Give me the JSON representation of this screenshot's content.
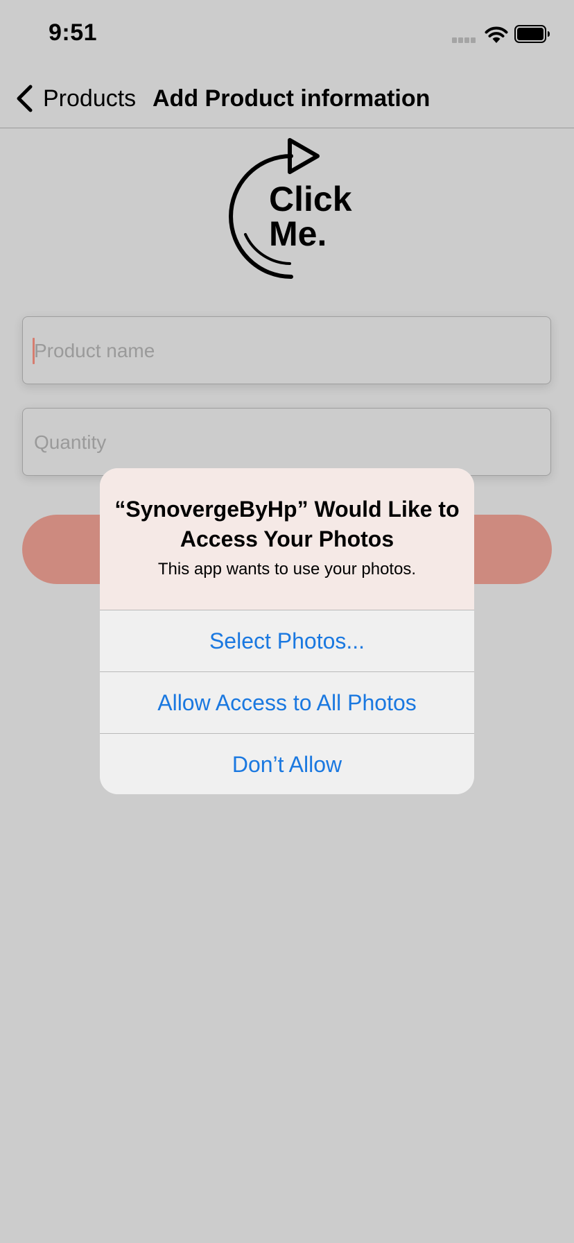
{
  "status_bar": {
    "time": "9:51"
  },
  "nav": {
    "back_label": "Products",
    "title": "Add Product information"
  },
  "click_me": {
    "line1": "Click",
    "line2": "Me."
  },
  "form": {
    "product_name_placeholder": "Product name",
    "quantity_placeholder": "Quantity"
  },
  "alert": {
    "title": "“SynovergeByHp” Would Like to Access Your Photos",
    "message": "This app wants to use your photos.",
    "actions": [
      {
        "label": "Select Photos..."
      },
      {
        "label": "Allow Access to All Photos"
      },
      {
        "label": "Don’t Allow"
      }
    ]
  },
  "colors": {
    "background": "#cccccc",
    "accent_button": "#cd8a7f",
    "alert_action_text": "#1a78e0",
    "caret": "#d67c6f"
  },
  "icons": [
    "signal-icon",
    "wifi-icon",
    "battery-icon",
    "chevron-left-icon",
    "circular-arrow-icon"
  ]
}
